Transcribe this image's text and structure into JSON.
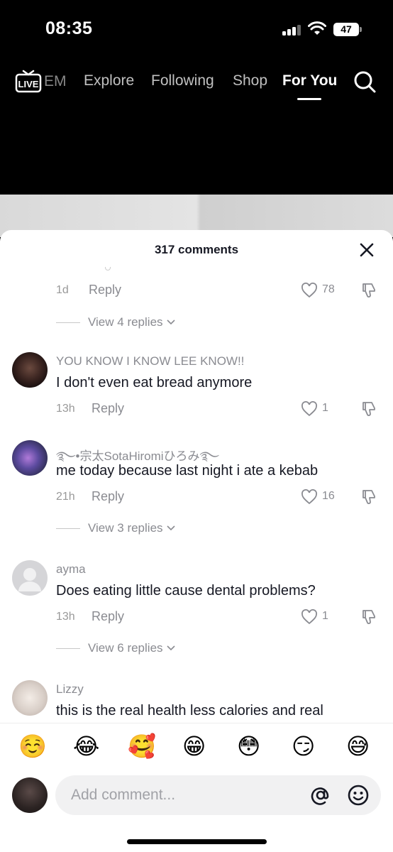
{
  "status_bar": {
    "time": "08:35",
    "battery": "47"
  },
  "top_nav": {
    "faded_tab": "EM",
    "tabs": [
      {
        "label": "Explore",
        "active": false
      },
      {
        "label": "Following",
        "active": false
      },
      {
        "label": "Shop",
        "active": false
      },
      {
        "label": "For You",
        "active": true
      }
    ],
    "live_label": "LIVE"
  },
  "comments_sheet": {
    "header": "317 comments",
    "first_partial": {
      "age": "1d",
      "reply": "Reply",
      "likes": "78",
      "view_replies": "View 4 replies"
    },
    "comments": [
      {
        "username": "YOU KNOW I KNOW LEE KNOW!!",
        "text": "I don't even eat bread anymore",
        "age": "13h",
        "reply": "Reply",
        "likes": "1",
        "view_replies": ""
      },
      {
        "username": "࿐•宗太SotaHiromiひろみ࿐",
        "text": "me today because last night i ate a kebab",
        "age": "21h",
        "reply": "Reply",
        "likes": "16",
        "view_replies": "View 3 replies"
      },
      {
        "username": "ayma",
        "text": "Does eating little cause dental problems?",
        "age": "13h",
        "reply": "Reply",
        "likes": "1",
        "view_replies": "View 6 replies"
      },
      {
        "username": "Lizzy",
        "text": "this is the real health less calories and real",
        "age": "",
        "reply": "",
        "likes": "",
        "view_replies": ""
      }
    ]
  },
  "emoji_bar": [
    "☺️",
    "😂",
    "🥰",
    "😁",
    "😳",
    "😏",
    "😅"
  ],
  "input": {
    "placeholder": "Add comment..."
  }
}
